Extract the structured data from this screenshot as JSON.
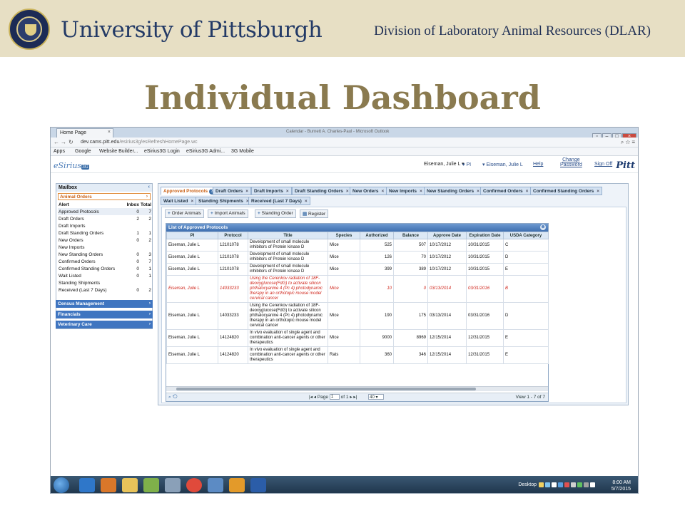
{
  "slide": {
    "university": "University of Pittsburgh",
    "division": "Division of Laboratory Animal Resources (DLAR)",
    "title": "Individual Dashboard"
  },
  "browser": {
    "tab_title": "Home Page",
    "window_title": "Calendar - Burnett A. Charles-Paul - Microsoft Outlook",
    "url_host": "dev.cams.pitt.edu",
    "url_path": "/esirius3g/esRefreshHomePage.wc",
    "bookmarks": [
      "Apps",
      "Google",
      "Website Builder...",
      "eSirius3G Login",
      "eSirius3G Admi...",
      "3G Mobile"
    ]
  },
  "app_header": {
    "logo": "eSirius",
    "logo_badge": "3G",
    "user": "Eiseman, Julie L",
    "role": "PI",
    "user2": "Eiseman, Julie L",
    "help": "Help",
    "change_password_1": "Change",
    "change_password_2": "Password",
    "sign_off": "Sign Off",
    "brand": "Pitt"
  },
  "sidebar": {
    "mailbox": "Mailbox",
    "animal_orders": "Animal Orders",
    "columns": [
      "Alert",
      "Inbox",
      "Total"
    ],
    "alerts": [
      {
        "label": "Approved Protocols",
        "inbox": "0",
        "total": "7"
      },
      {
        "label": "Draft Orders",
        "inbox": "2",
        "total": "2"
      },
      {
        "label": "Draft Imports",
        "inbox": "",
        "total": ""
      },
      {
        "label": "Draft Standing Orders",
        "inbox": "1",
        "total": "1"
      },
      {
        "label": "New Orders",
        "inbox": "0",
        "total": "2"
      },
      {
        "label": "New Imports",
        "inbox": "",
        "total": ""
      },
      {
        "label": "New Standing Orders",
        "inbox": "0",
        "total": "3"
      },
      {
        "label": "Confirmed Orders",
        "inbox": "0",
        "total": "7"
      },
      {
        "label": "Confirmed Standing Orders",
        "inbox": "0",
        "total": "1"
      },
      {
        "label": "Wait Listed",
        "inbox": "0",
        "total": "1"
      },
      {
        "label": "Standing Shipments",
        "inbox": "",
        "total": ""
      },
      {
        "label": "Received (Last 7 Days)",
        "inbox": "0",
        "total": "2"
      }
    ],
    "sections": [
      "Census Management",
      "Financials",
      "Veterinary Care"
    ]
  },
  "tabs": {
    "row1": [
      "Approved Protocols",
      "Draft Orders",
      "Draft Imports",
      "Draft Standing Orders",
      "New Orders",
      "New Imports",
      "New Standing Orders",
      "Confirmed Orders",
      "Confirmed Standing Orders"
    ],
    "row2": [
      "Wait Listed",
      "Standing Shipments",
      "Received (Last 7 Days)"
    ]
  },
  "toolbar": {
    "order_animals": "Order Animals",
    "import_animals": "Import Animals",
    "standing_order": "Standing Order",
    "register": "Register"
  },
  "grid": {
    "caption": "List of Approved Protocols",
    "columns": [
      "PI",
      "Protocol",
      "Title",
      "Species",
      "Authorized",
      "Balance",
      "Approve Date",
      "Expiration Date",
      "USDA Category"
    ],
    "rows": [
      {
        "pi": "Eiseman, Julie L",
        "protocol": "12101078",
        "title": "Development of small molecule inhibitors of Protein kinase D",
        "species": "Mice",
        "authorized": "525",
        "balance": "507",
        "approve": "10/17/2012",
        "expire": "10/31/2015",
        "usda": "C",
        "hl": false
      },
      {
        "pi": "Eiseman, Julie L",
        "protocol": "12101078",
        "title": "Development of small molecule inhibitors of Protein kinase D",
        "species": "Mice",
        "authorized": "126",
        "balance": "70",
        "approve": "10/17/2012",
        "expire": "10/31/2015",
        "usda": "D",
        "hl": false
      },
      {
        "pi": "Eiseman, Julie L",
        "protocol": "12101078",
        "title": "Development of small molecule inhibitors of Protein kinase D",
        "species": "Mice",
        "authorized": "399",
        "balance": "389",
        "approve": "10/17/2012",
        "expire": "10/31/2015",
        "usda": "E",
        "hl": false
      },
      {
        "pi": "Eiseman, Julie L",
        "protocol": "14033233",
        "title": "Using the Cerenkov radiation of 18F-deoxyglucose(FdG) to activate silicon phthalocyanine 4 (Pc 4) photodynamic therapy in an orthotopic mouse model cervical cancer",
        "species": "Mice",
        "authorized": "10",
        "balance": "0",
        "approve": "03/13/2014",
        "expire": "03/31/2016",
        "usda": "B",
        "hl": true
      },
      {
        "pi": "Eiseman, Julie L",
        "protocol": "14033233",
        "title": "Using the Cerenkov radiation of 18F-deoxyglucose(FdG) to activate silicon phthalocyanine 4 (Pc 4) photodynamic therapy in an orthotopic mouse model cervical cancer",
        "species": "Mice",
        "authorized": "190",
        "balance": "175",
        "approve": "03/13/2014",
        "expire": "03/31/2016",
        "usda": "D",
        "hl": false
      },
      {
        "pi": "Eiseman, Julie L",
        "protocol": "14124820",
        "title": "In vivo evaluation of single agent and combination anti-cancer agents or other therapeutics",
        "species": "Mice",
        "authorized": "9000",
        "balance": "8969",
        "approve": "12/15/2014",
        "expire": "12/31/2015",
        "usda": "E",
        "hl": false
      },
      {
        "pi": "Eiseman, Julie L",
        "protocol": "14124820",
        "title": "In vivo evaluation of single agent and combination anti-cancer agents or other therapeutics",
        "species": "Rats",
        "authorized": "360",
        "balance": "346",
        "approve": "12/15/2014",
        "expire": "12/31/2015",
        "usda": "E",
        "hl": false
      }
    ],
    "pager_page_label": "Page",
    "pager_page": "1",
    "pager_of": "of 1",
    "pager_size": "40",
    "pager_view": "View 1 - 7 of 7"
  },
  "taskbar": {
    "desktop": "Desktop",
    "time": "8:00 AM",
    "date": "5/7/2015"
  }
}
